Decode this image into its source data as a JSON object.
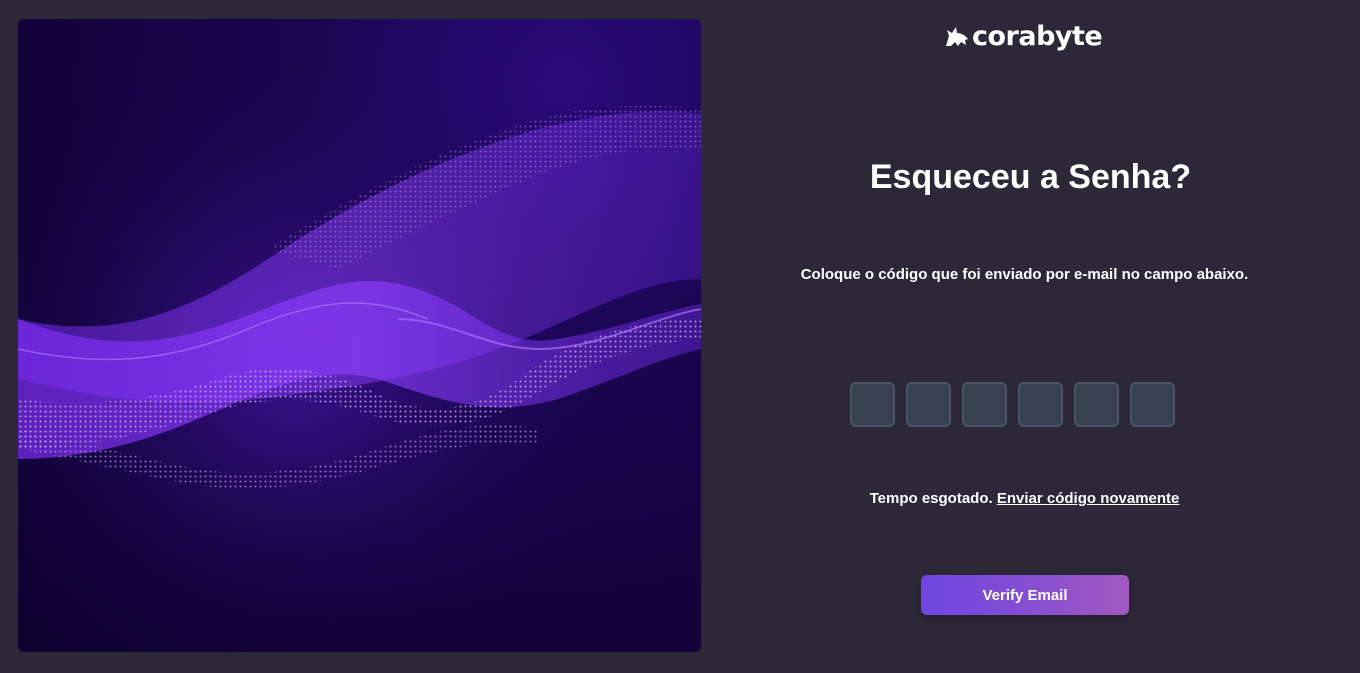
{
  "brand": {
    "logo_text": "corabyte",
    "logo_icon": "wolf-icon"
  },
  "hero": {
    "image": "purple-particle-wave",
    "colors": {
      "bg": "#14043d",
      "wave": "#8b3dff",
      "glow": "#b57bff"
    }
  },
  "form": {
    "title": "Esqueceu a Senha?",
    "instruction": "Coloque o código que foi enviado por e-mail no campo abaixo.",
    "code_fields": [
      {
        "value": ""
      },
      {
        "value": ""
      },
      {
        "value": ""
      },
      {
        "value": ""
      },
      {
        "value": ""
      },
      {
        "value": ""
      }
    ],
    "timeout_text": "Tempo esgotado.",
    "resend_link": "Enviar código novamente",
    "verify_button": "Verify Email"
  },
  "colors": {
    "background": "#2d2838",
    "input_bg": "#374151",
    "input_border": "#4b5563",
    "button_gradient_start": "#6d45e0",
    "button_gradient_end": "#a259bf"
  }
}
